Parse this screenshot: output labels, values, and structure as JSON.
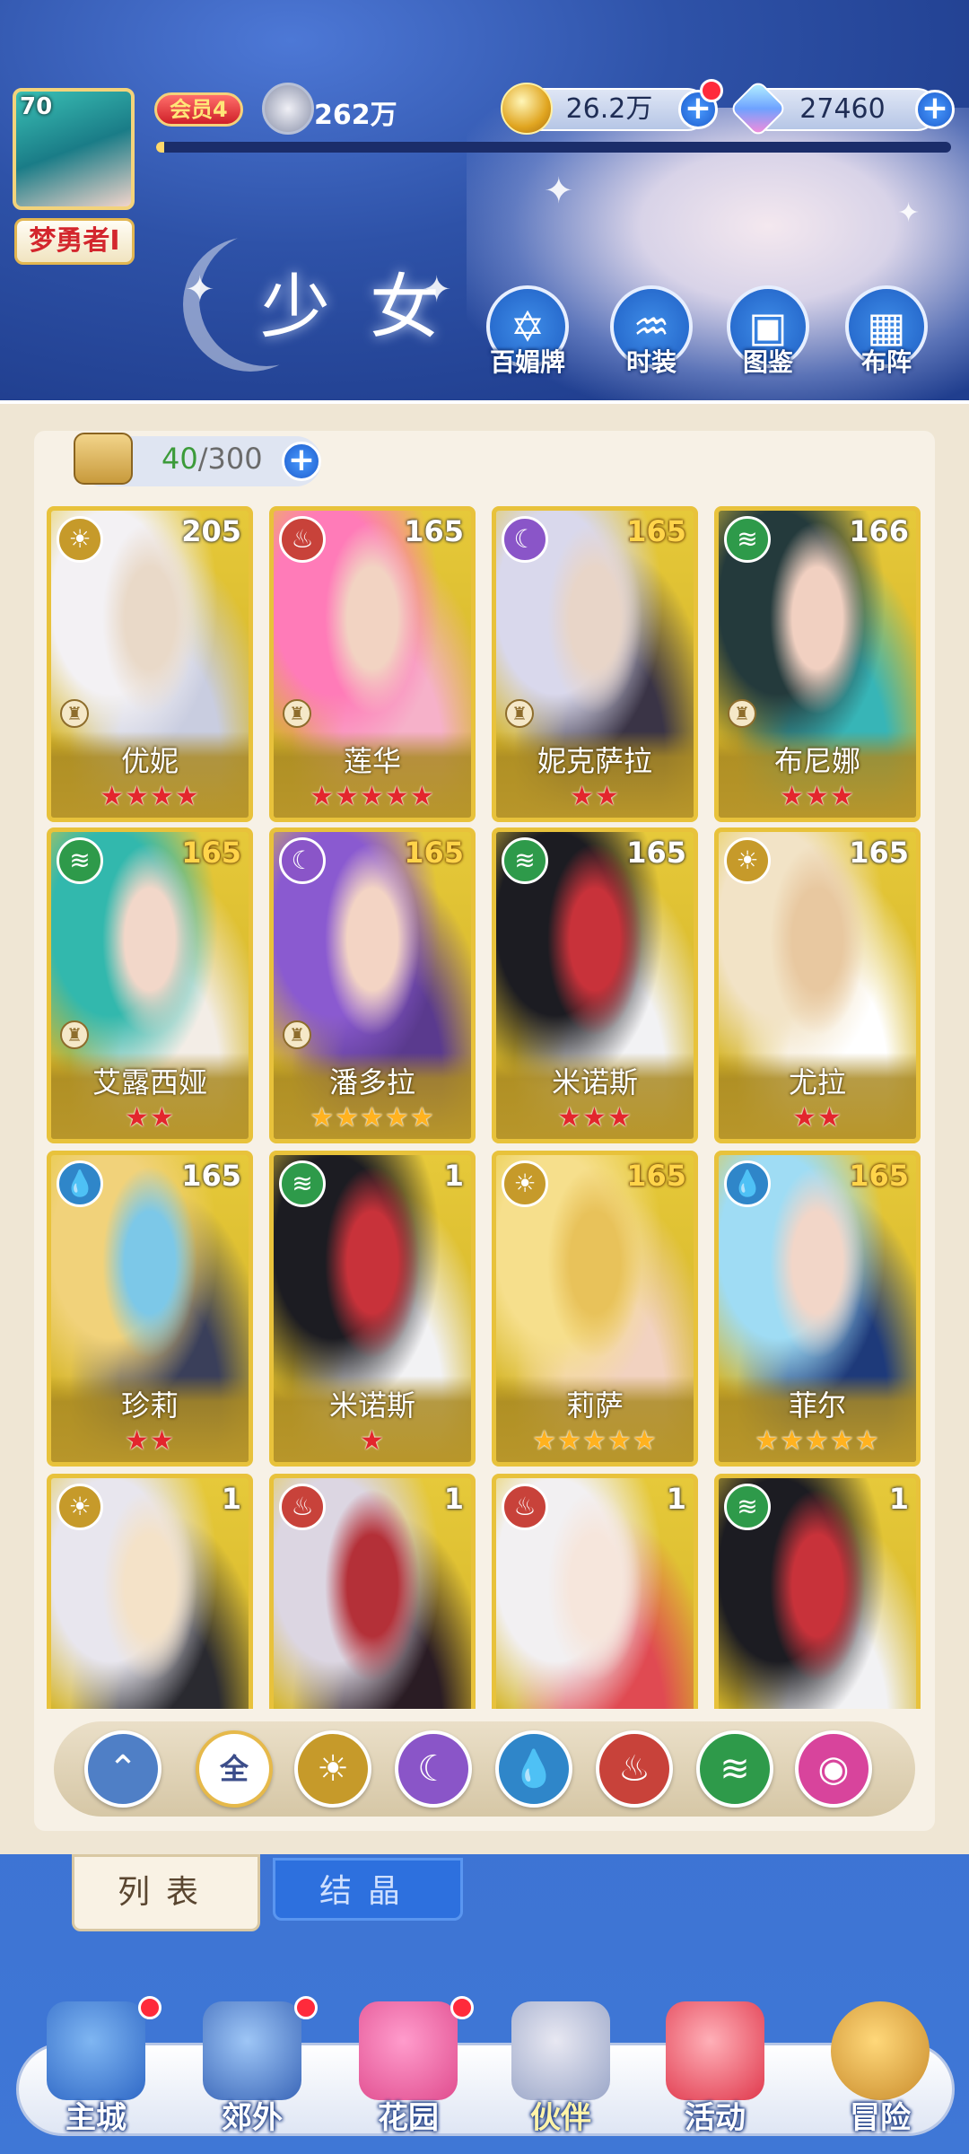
{
  "player": {
    "level": "70",
    "name": "梦勇者I",
    "vip": "会员4",
    "power": "262万",
    "exp_fraction": 0.01
  },
  "resources": {
    "gold": "26.2万",
    "gems": "27460"
  },
  "section_title": "少女",
  "top_buttons": [
    {
      "label": "百媚牌",
      "icon": "hexagram-card-icon"
    },
    {
      "label": "时装",
      "icon": "dress-icon"
    },
    {
      "label": "图鉴",
      "icon": "book-icon"
    },
    {
      "label": "布阵",
      "icon": "formation-grid-icon"
    }
  ],
  "inventory": {
    "current": "40",
    "max": "/300"
  },
  "element_colors": {
    "light": "#c69a2a",
    "fire": "#c8423a",
    "dark": "#8a55c8",
    "wind": "#2e9a4a",
    "water": "#2f86c9",
    "love": "#d8449c"
  },
  "cards": [
    {
      "name": "优妮",
      "level": "205",
      "element": "light",
      "element_icon": "sun-icon",
      "stars": "★★★★",
      "star_color": "red",
      "level_gold": false,
      "locked": true,
      "art": [
        "#f3f1f4",
        "#c9cde0",
        "#e9d9c8"
      ]
    },
    {
      "name": "莲华",
      "level": "165",
      "element": "fire",
      "element_icon": "flame-icon",
      "stars": "★★★★★",
      "star_color": "red",
      "level_gold": false,
      "locked": true,
      "art": [
        "#ff7bb8",
        "#f6b1c9",
        "#f2d3c2"
      ]
    },
    {
      "name": "妮克萨拉",
      "level": "165",
      "element": "dark",
      "element_icon": "crescent-icon",
      "stars": "★★",
      "star_color": "red",
      "level_gold": true,
      "locked": true,
      "art": [
        "#d9d8ec",
        "#3a3446",
        "#e8d5c8"
      ]
    },
    {
      "name": "布尼娜",
      "level": "166",
      "element": "wind",
      "element_icon": "whirlwind-icon",
      "stars": "★★★",
      "star_color": "red",
      "level_gold": false,
      "locked": true,
      "art": [
        "#243a3c",
        "#37b5b7",
        "#f1d0c1"
      ]
    },
    {
      "name": "艾露西娅",
      "level": "165",
      "element": "wind",
      "element_icon": "whirlwind-icon",
      "stars": "★★",
      "star_color": "red",
      "level_gold": true,
      "locked": true,
      "art": [
        "#32b8ad",
        "#f3ede6",
        "#f2d7c9"
      ]
    },
    {
      "name": "潘多拉",
      "level": "165",
      "element": "dark",
      "element_icon": "crescent-icon",
      "stars": "★★★★★",
      "star_color": "gold",
      "level_gold": true,
      "locked": true,
      "art": [
        "#8a5ad0",
        "#5a3a8e",
        "#f3d4c4"
      ]
    },
    {
      "name": "米诺斯",
      "level": "165",
      "element": "wind",
      "element_icon": "whirlwind-icon",
      "stars": "★★★",
      "star_color": "red",
      "level_gold": false,
      "locked": false,
      "art": [
        "#1c1c22",
        "#f2f2f4",
        "#c8323a"
      ]
    },
    {
      "name": "尤拉",
      "level": "165",
      "element": "light",
      "element_icon": "sun-icon",
      "stars": "★★",
      "star_color": "red",
      "level_gold": false,
      "locked": false,
      "art": [
        "#f2e3c6",
        "#ffffff",
        "#e8c8a0"
      ]
    },
    {
      "name": "珍莉",
      "level": "165",
      "element": "water",
      "element_icon": "droplet-icon",
      "stars": "★★",
      "star_color": "red",
      "level_gold": false,
      "locked": false,
      "art": [
        "#f1d27a",
        "#3a3f5a",
        "#7cc8e8"
      ]
    },
    {
      "name": "米诺斯",
      "level": "1",
      "element": "wind",
      "element_icon": "whirlwind-icon",
      "stars": "★",
      "star_color": "red",
      "level_gold": false,
      "locked": false,
      "art": [
        "#1c1c22",
        "#f2f2f4",
        "#c8323a"
      ]
    },
    {
      "name": "莉萨",
      "level": "165",
      "element": "light",
      "element_icon": "sun-icon",
      "stars": "★★★★★",
      "star_color": "gold",
      "level_gold": true,
      "locked": false,
      "art": [
        "#f6df8c",
        "#f2d2c0",
        "#e8c25a"
      ]
    },
    {
      "name": "菲尔",
      "level": "165",
      "element": "water",
      "element_icon": "droplet-icon",
      "stars": "★★★★★",
      "star_color": "gold",
      "level_gold": true,
      "locked": false,
      "art": [
        "#9fdcf4",
        "#1e3a7a",
        "#f2d6c8"
      ]
    },
    {
      "name": "",
      "level": "1",
      "element": "light",
      "element_icon": "sun-icon",
      "stars": "",
      "star_color": "red",
      "level_gold": false,
      "locked": false,
      "art": [
        "#e8e6ee",
        "#2a2a30",
        "#f4e2c8"
      ]
    },
    {
      "name": "",
      "level": "1",
      "element": "fire",
      "element_icon": "flame-icon",
      "stars": "",
      "star_color": "red",
      "level_gold": false,
      "locked": false,
      "art": [
        "#dcd6e2",
        "#2a1c24",
        "#b43038"
      ]
    },
    {
      "name": "",
      "level": "1",
      "element": "fire",
      "element_icon": "flame-icon",
      "stars": "",
      "star_color": "red",
      "level_gold": false,
      "locked": false,
      "art": [
        "#f2f0f2",
        "#e04a52",
        "#f6e6dc"
      ]
    },
    {
      "name": "",
      "level": "1",
      "element": "wind",
      "element_icon": "whirlwind-icon",
      "stars": "",
      "star_color": "red",
      "level_gold": false,
      "locked": false,
      "art": [
        "#1c1c22",
        "#f2f2f4",
        "#c8323a"
      ]
    }
  ],
  "filters": [
    {
      "name": "collapse-filter-button",
      "icon": "chevron-up-icon",
      "glyph": "⌃",
      "color": "#4f7fc6"
    },
    {
      "name": "filter-all-button",
      "icon": "all-icon",
      "glyph": "全",
      "color": "#ffffff"
    },
    {
      "name": "filter-light-button",
      "icon": "sun-icon",
      "glyph": "☀",
      "color": "#c69a2a"
    },
    {
      "name": "filter-dark-button",
      "icon": "crescent-icon",
      "glyph": "☾",
      "color": "#8a55c8"
    },
    {
      "name": "filter-water-button",
      "icon": "droplet-icon",
      "glyph": "💧",
      "color": "#2f86c9"
    },
    {
      "name": "filter-fire-button",
      "icon": "flame-icon",
      "glyph": "♨",
      "color": "#c8423a"
    },
    {
      "name": "filter-wind-button",
      "icon": "whirlwind-icon",
      "glyph": "≋",
      "color": "#2e9a4a"
    },
    {
      "name": "filter-love-button",
      "icon": "heart-orb-icon",
      "glyph": "◉",
      "color": "#d8449c"
    }
  ],
  "tabs": {
    "list": "列表",
    "crystal": "结晶"
  },
  "nav": [
    {
      "label": "主城",
      "icon": "castle-icon",
      "badge": true,
      "active": false,
      "colors": [
        "#7fb6f2",
        "#2f68c6"
      ]
    },
    {
      "label": "郊外",
      "icon": "portal-icon",
      "badge": true,
      "active": false,
      "colors": [
        "#9ec6f6",
        "#3a66b8"
      ]
    },
    {
      "label": "花园",
      "icon": "heart-garden-icon",
      "badge": true,
      "active": false,
      "colors": [
        "#ff9ccc",
        "#e04c8e"
      ]
    },
    {
      "label": "伙伴",
      "icon": "partner-portrait-icon",
      "badge": false,
      "active": true,
      "colors": [
        "#e8e8f2",
        "#9aa6c8"
      ]
    },
    {
      "label": "活动",
      "icon": "gift-box-icon",
      "badge": false,
      "active": false,
      "colors": [
        "#ffb0b8",
        "#e0384c"
      ]
    },
    {
      "label": "冒险",
      "icon": "compass-sword-icon",
      "badge": false,
      "active": false,
      "colors": [
        "#ffd87a",
        "#c88a2a"
      ]
    }
  ]
}
